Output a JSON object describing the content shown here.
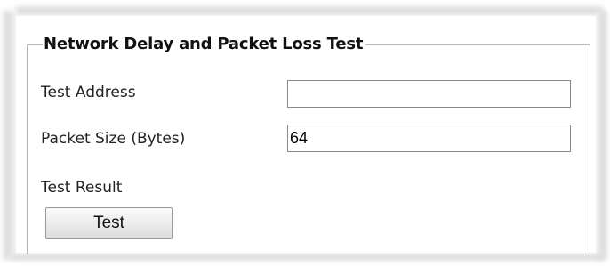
{
  "group": {
    "title": "Network Delay and Packet Loss Test"
  },
  "fields": {
    "test_address": {
      "label": "Test Address",
      "value": ""
    },
    "packet_size": {
      "label": "Packet Size (Bytes)",
      "value": "64"
    }
  },
  "result": {
    "label": "Test Result"
  },
  "actions": {
    "test_label": "Test"
  },
  "colors": {
    "border": "#b5b5b5",
    "input_border": "#8a8a8a",
    "button_top": "#fbfbfb",
    "button_bottom": "#dcdcdc"
  }
}
